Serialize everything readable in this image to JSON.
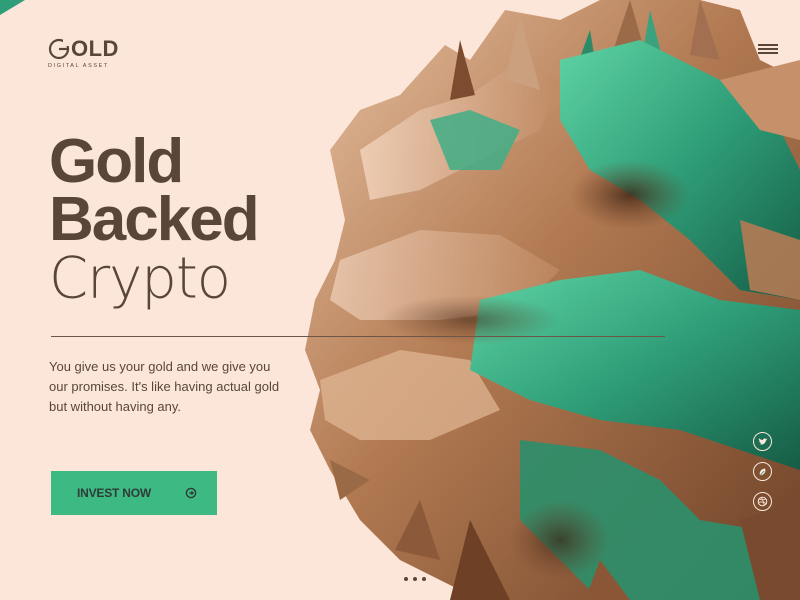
{
  "brand": {
    "logo_text": "OLD",
    "tagline": "DIGITAL ASSET"
  },
  "hero": {
    "line1": "Gold",
    "line2": "Backed",
    "line3": "Crypto",
    "description": "You give us your gold and we give you our promises. It's like having actual gold but without having any."
  },
  "cta": {
    "label": "INVEST NOW",
    "icon": "arrow-circle-icon"
  },
  "social": [
    {
      "icon": "twitter-icon"
    },
    {
      "icon": "instagram-icon"
    },
    {
      "icon": "dribbble-icon"
    }
  ],
  "menu": {
    "icon": "hamburger-menu-icon"
  },
  "pager": {
    "pages": 3
  },
  "colors": {
    "background": "#fce6da",
    "text": "#5a4639",
    "accent": "#3dba84",
    "art_copper": "#b7825d",
    "art_teal": "#2f9e78"
  }
}
